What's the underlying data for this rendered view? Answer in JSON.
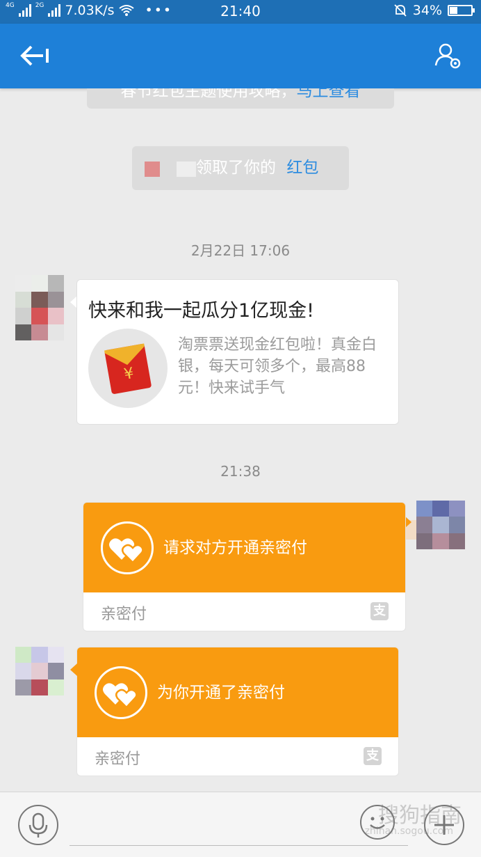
{
  "status_bar": {
    "net1": "4G",
    "net2": "2G",
    "speed": "7.03K/s",
    "dots": "•••",
    "time": "21:40",
    "battery": "34%",
    "battery_level": 0.34
  },
  "title_bar": {
    "back_icon": "back-arrow-icon",
    "profile_icon": "contact-settings-icon"
  },
  "chat": {
    "tip1": {
      "text": "春节红包主题使用攻略，",
      "link": "马上查看"
    },
    "tip2": {
      "text": "领取了你的",
      "link": "红包"
    },
    "time1": "2月22日 17:06",
    "share_card": {
      "title": "快来和我一起瓜分1亿现金!",
      "desc": "淘票票送现金红包啦！真金白银，每天可领多个，最高88元！快来试手气",
      "icon": "red-envelope-icon",
      "yuan": "¥"
    },
    "time2": "21:38",
    "request_card": {
      "message": "请求对方开通亲密付",
      "footer": "亲密付",
      "alipay_glyph": "支"
    },
    "opened_card": {
      "message": "为你开通了亲密付",
      "footer": "亲密付",
      "alipay_glyph": "支"
    }
  },
  "input_bar": {
    "voice_icon": "microphone-icon",
    "emoji_icon": "smiley-icon",
    "plus_icon": "plus-icon",
    "watermark": "搜狗指南",
    "watermark_sub": "zhinan.sogou.com"
  },
  "colors": {
    "header": "#1e80d8",
    "orange": "#f99b10",
    "link": "#2c8ce0"
  }
}
